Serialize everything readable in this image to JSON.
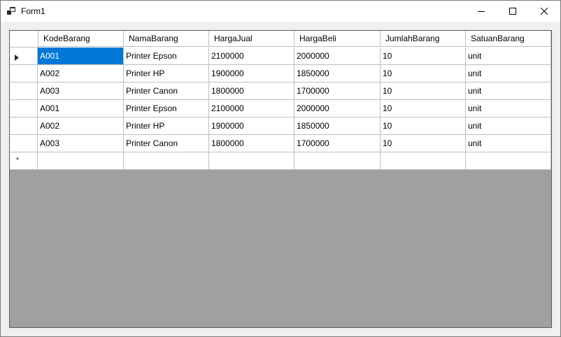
{
  "window": {
    "title": "Form1",
    "icon": "form-app-icon",
    "controls": [
      "minimize-icon",
      "maximize-icon",
      "close-icon"
    ]
  },
  "grid": {
    "columns": [
      "KodeBarang",
      "NamaBarang",
      "HargaJual",
      "HargaBeli",
      "JumlahBarang",
      "SatuanBarang"
    ],
    "rows": [
      [
        "A001",
        "Printer Epson",
        "2100000",
        "2000000",
        "10",
        "unit"
      ],
      [
        "A002",
        "Printer HP",
        "1900000",
        "1850000",
        "10",
        "unit"
      ],
      [
        "A003",
        "Printer Canon",
        "1800000",
        "1700000",
        "10",
        "unit"
      ],
      [
        "A001",
        "Printer Epson",
        "2100000",
        "2000000",
        "10",
        "unit"
      ],
      [
        "A002",
        "Printer HP",
        "1900000",
        "1850000",
        "10",
        "unit"
      ],
      [
        "A003",
        "Printer Canon",
        "1800000",
        "1700000",
        "10",
        "unit"
      ]
    ],
    "new_row_marker": "*",
    "current_row_marker": "triangle-right-icon",
    "selected_cell_color": "#0078d7",
    "empty_area_color": "#a0a0a0"
  }
}
